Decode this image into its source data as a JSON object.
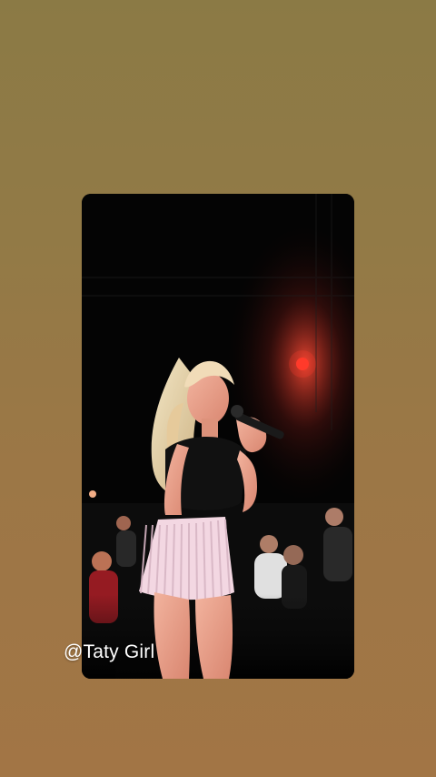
{
  "story": {
    "background_gradient": [
      "#8b7a45",
      "#a27545"
    ],
    "media_alt": "concert-performance-photo",
    "watermark_text": "@Taty Girl"
  },
  "colors": {
    "card_bg": "#050505",
    "stage_light": "#ff3a2a",
    "skin": "#e7a08c",
    "top": "#111111",
    "fringe_skirt": "#f3d7e2"
  }
}
